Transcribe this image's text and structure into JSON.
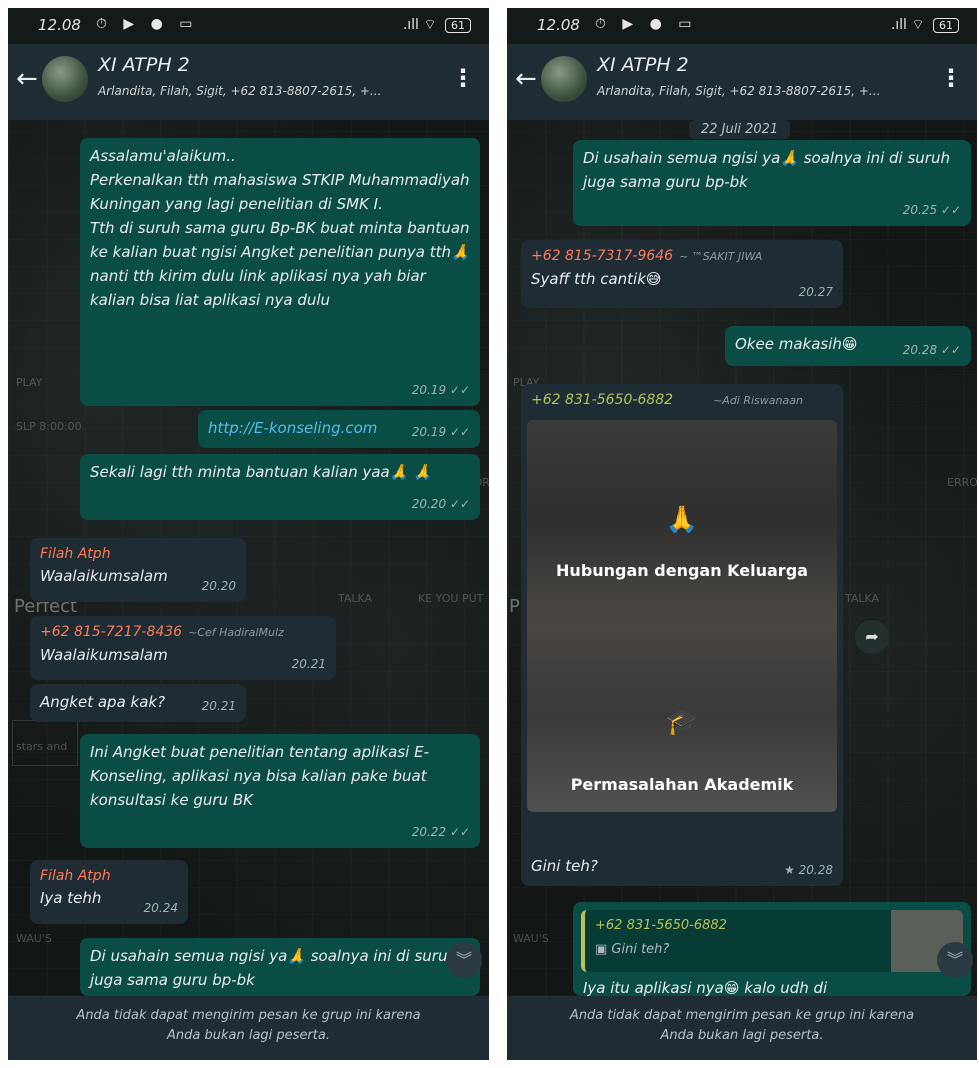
{
  "left": {
    "status": {
      "time": "12.08",
      "icons": "⏱ ▶ ● ▭",
      "signal": ".ıll ⌔",
      "battery": "61"
    },
    "header": {
      "title": "XI ATPH 2",
      "subtitle": "Arlandita, Filah, Sigit, +62 813-8807-2615, +..."
    },
    "messages": [
      {
        "type": "out",
        "text": "Assalamu'alaikum..\nPerkenalkan tth mahasiswa STKIP Muhammadiyah Kuningan yang lagi penelitian di SMK I.\nTth di suruh sama guru Bp-BK buat minta bantuan ke kalian buat ngisi Angket penelitian punya tth🙏 nanti tth kirim dulu link aplikasi nya yah biar kalian bisa liat aplikasi nya dulu",
        "time": "20.19 ✓✓"
      },
      {
        "type": "out",
        "text": "http://E-konseling.com",
        "time": "20.19 ✓✓"
      },
      {
        "type": "out",
        "text": "Sekali lagi tth minta bantuan kalian yaa🙏 🙏",
        "time": "20.20 ✓✓"
      },
      {
        "type": "in",
        "sender": "Filah Atph",
        "text": "Waalaikumsalam",
        "time": "20.20"
      },
      {
        "type": "in",
        "sender": "+62 815-7217-8436",
        "alias": "~Cef HadiralMulz",
        "text": "Waalaikumsalam",
        "time": "20.21"
      },
      {
        "type": "in",
        "text": "Angket apa kak?",
        "time": "20.21"
      },
      {
        "type": "out",
        "text": "Ini Angket buat penelitian tentang aplikasi E-Konseling, aplikasi nya bisa kalian pake buat konsultasi ke guru BK",
        "time": "20.22 ✓✓"
      },
      {
        "type": "in",
        "sender": "Filah Atph",
        "text": "Iya tehh",
        "time": "20.24"
      },
      {
        "type": "out",
        "text": "Di usahain semua ngisi ya🙏 soalnya ini di suruh juga sama guru bp-bk",
        "time": ""
      }
    ],
    "footer": "Anda tidak dapat mengirim pesan ke grup ini karena\nAnda bukan lagi peserta."
  },
  "right": {
    "status": {
      "time": "12.08",
      "icons": "⏱ ▶ ● ▭",
      "signal": ".ıll ⌔",
      "battery": "61"
    },
    "header": {
      "title": "XI ATPH 2",
      "subtitle": "Arlandita, Filah, Sigit, +62 813-8807-2615, +..."
    },
    "date_pill": "22 Juli 2021",
    "messages": [
      {
        "type": "out",
        "text": "Di usahain semua ngisi ya🙏 soalnya ini di suruh juga sama guru bp-bk",
        "time": "20.25 ✓✓"
      },
      {
        "type": "in",
        "sender": "+62 815-7317-9646",
        "alias": "~ ™SAKIT JIWA",
        "text": "Syaff tth cantik😅",
        "time": "20.27"
      },
      {
        "type": "out",
        "text": "Okee makasih😁",
        "time": "20.28 ✓✓"
      },
      {
        "type": "in",
        "sender": "+62 831-5650-6882",
        "alias": "~Adi Riswanaan",
        "card_top": "Hubungan dengan Keluarga",
        "card_bottom": "Permasalahan Akademik",
        "text": "Gini teh?",
        "time": "★ 20.28"
      },
      {
        "type": "out",
        "quote_sender": "+62 831-5650-6882",
        "quote_text": "▣ Gini teh?",
        "text": "Iya itu aplikasi nya😁 kalo udh di",
        "time": ""
      }
    ],
    "footer": "Anda tidak dapat mengirim pesan ke grup ini karena\nAnda bukan lagi peserta."
  }
}
